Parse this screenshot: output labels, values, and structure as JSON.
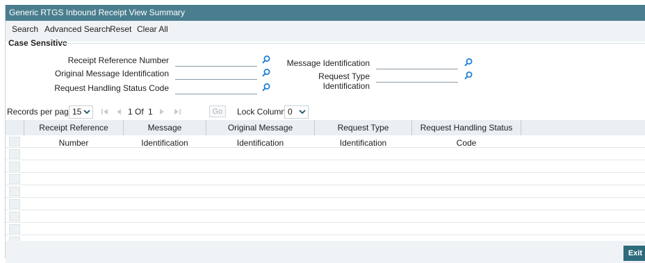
{
  "window": {
    "title": "Generic RTGS Inbound Receipt View Summary"
  },
  "toolbar": {
    "search": "Search",
    "advanced_search": "Advanced Search",
    "reset": "Reset",
    "clear_all": "Clear All"
  },
  "criteria": {
    "section_title": "Case Sensitive",
    "fields": {
      "receipt_reference_number": {
        "label": "Receipt Reference Number",
        "value": ""
      },
      "original_message_identification": {
        "label": "Original Message Identification",
        "value": ""
      },
      "request_handling_status_code": {
        "label": "Request Handling Status Code",
        "value": ""
      },
      "message_identification": {
        "label": "Message Identification",
        "value": ""
      },
      "request_type_identification": {
        "label": "Request Type Identification",
        "value": ""
      }
    },
    "lookup_icon": "search-icon"
  },
  "pagination": {
    "records_per_page_label": "Records per page",
    "records_per_page": "15",
    "current_page": "1",
    "of_label": "Of",
    "total_pages": "1",
    "go_label": "Go",
    "lock_columns_label": "Lock Columns",
    "lock_columns": "0"
  },
  "grid": {
    "columns": [
      "Receipt Reference Number",
      "Message Identification",
      "Original Message Identification",
      "Request Type Identification",
      "Request Handling Status Code"
    ],
    "rows": []
  },
  "footer": {
    "exit_label": "Exit"
  },
  "colors": {
    "title_bar": "#4a7e8e",
    "toolbar_bg": "#eff3f5",
    "accent_button": "#2e6c7c",
    "lookup_icon": "#1f7fd6"
  }
}
